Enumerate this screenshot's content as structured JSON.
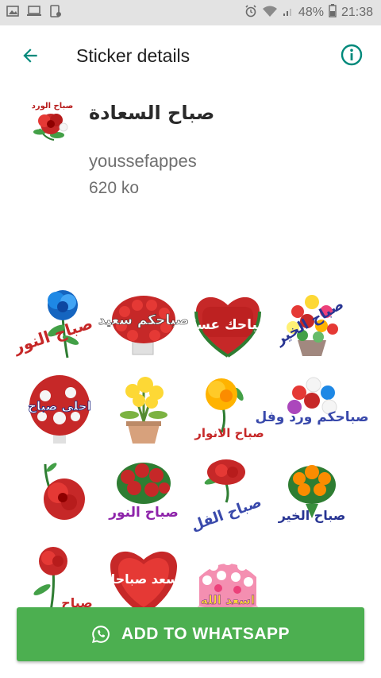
{
  "status_bar": {
    "battery": "48%",
    "time": "21:38",
    "icons": [
      "image-icon",
      "laptop-icon",
      "tablet-icon",
      "alarm-icon",
      "wifi-icon",
      "signal-icon",
      "battery-icon"
    ]
  },
  "app_bar": {
    "title": "Sticker details",
    "back_icon": "arrow-back-icon",
    "info_icon": "info-icon"
  },
  "pack": {
    "tray_caption": "صباح الورد",
    "name": "صباح السعادة",
    "publisher": "youssefappes",
    "size": "620 ko"
  },
  "stickers": [
    {
      "caption": "صباح النور",
      "kind": "blue-rose"
    },
    {
      "caption": "صباحكم سعيد",
      "kind": "red-bouquet"
    },
    {
      "caption": "صباحك عسل",
      "kind": "red-heart"
    },
    {
      "caption": "صباح الخير",
      "kind": "flower-basket"
    },
    {
      "caption": "احلى صباح",
      "kind": "round-bouquet"
    },
    {
      "caption": "",
      "kind": "yellow-pot"
    },
    {
      "caption": "صباح الانوار",
      "kind": "yellow-rose"
    },
    {
      "caption": "صباحكم ورد وفل",
      "kind": "mixed-bouquet"
    },
    {
      "caption": "",
      "kind": "single-rose"
    },
    {
      "caption": "صباح النور",
      "kind": "rose-vase"
    },
    {
      "caption": "صباح الفل",
      "kind": "rose-script"
    },
    {
      "caption": "صباح الخير",
      "kind": "orange-bouquet"
    },
    {
      "caption": "صباح",
      "kind": "rose-bud"
    },
    {
      "caption": "يسعد صباحك",
      "kind": "heart-frame"
    },
    {
      "caption": "اسعد الله",
      "kind": "pink-cake"
    }
  ],
  "add_button": {
    "label": "ADD TO WHATSAPP",
    "icon": "whatsapp-icon"
  },
  "colors": {
    "accent": "#00897b",
    "button": "#4caf50",
    "status_bar": "#e3e3e3"
  }
}
